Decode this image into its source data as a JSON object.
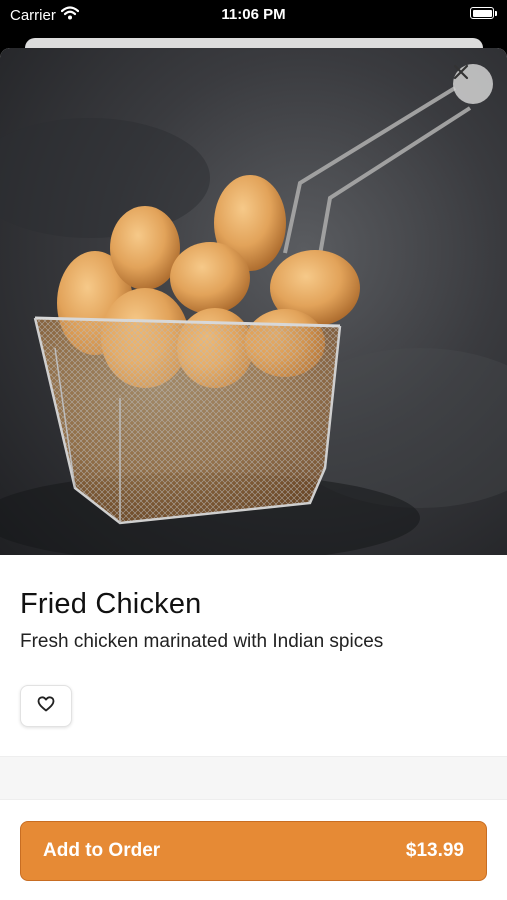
{
  "status_bar": {
    "carrier": "Carrier",
    "time": "11:06 PM"
  },
  "item": {
    "name": "Fried Chicken",
    "description": "Fresh chicken marinated with Indian spices",
    "image_alt": "Fried chicken tenders in a wire basket"
  },
  "actions": {
    "add_label": "Add to Order",
    "price": "$13.99"
  },
  "colors": {
    "accent": "#e68a35",
    "accent_border": "#c86d22"
  },
  "icons": {
    "close": "close-icon",
    "favorite": "heart-icon",
    "wifi": "wifi-icon",
    "battery": "battery-icon"
  }
}
